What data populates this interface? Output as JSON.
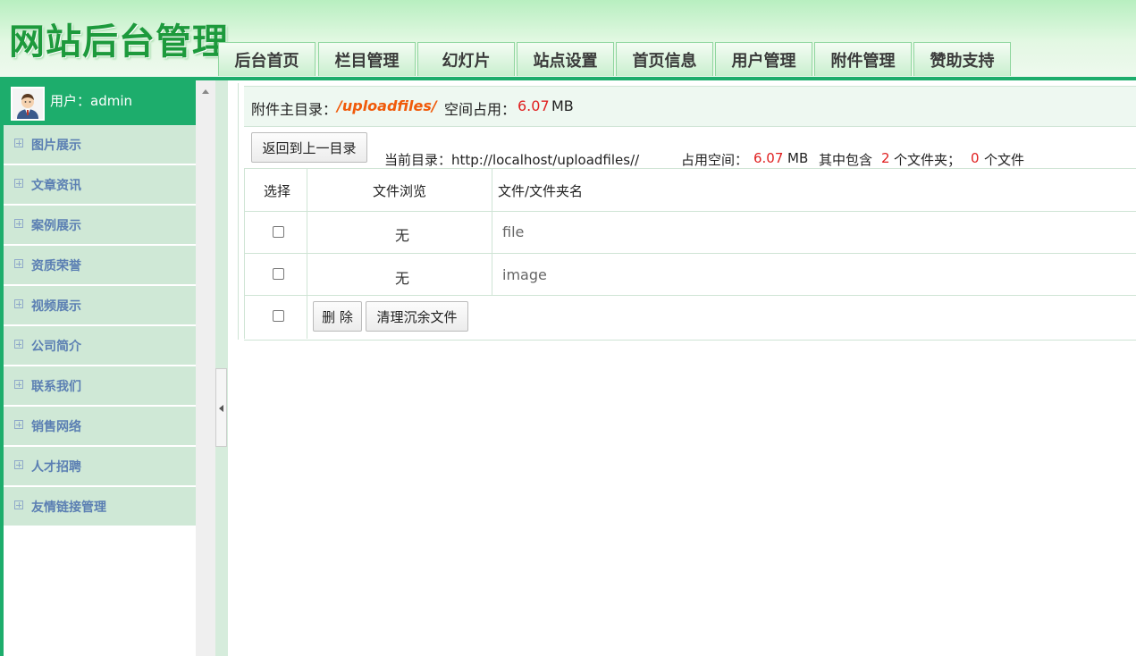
{
  "app": {
    "title": "网站后台管理"
  },
  "nav": {
    "tabs": [
      {
        "label": "后台首页"
      },
      {
        "label": "栏目管理"
      },
      {
        "label": "幻灯片"
      },
      {
        "label": "站点设置"
      },
      {
        "label": "首页信息"
      },
      {
        "label": "用户管理"
      },
      {
        "label": "附件管理"
      },
      {
        "label": "赞助支持"
      }
    ]
  },
  "sidebar": {
    "user_label": "用户：admin",
    "items": [
      {
        "label": "图片展示"
      },
      {
        "label": "文章资讯"
      },
      {
        "label": "案例展示"
      },
      {
        "label": "资质荣誉"
      },
      {
        "label": "视频展示"
      },
      {
        "label": "公司简介"
      },
      {
        "label": "联系我们"
      },
      {
        "label": "销售网络"
      },
      {
        "label": "人才招聘"
      },
      {
        "label": "友情链接管理"
      }
    ]
  },
  "info": {
    "root_label": "附件主目录：",
    "root_path": "/uploadfiles/",
    "space_label": "空间占用：",
    "space_value": "6.07",
    "space_unit": "MB"
  },
  "directory": {
    "back_button": "返回到上一目录",
    "current_label": "当前目录：http://localhost/uploadfiles//",
    "used_label": "占用空间：",
    "used_value": "6.07",
    "used_unit": "MB",
    "contains_label": "其中包含",
    "folder_count": "2",
    "folder_unit": "个文件夹；",
    "file_count": "0",
    "file_unit": "个文件"
  },
  "table": {
    "headers": [
      "选择",
      "文件浏览",
      "文件/文件夹名"
    ],
    "rows": [
      {
        "preview": "无",
        "name": "file"
      },
      {
        "preview": "无",
        "name": "image"
      }
    ],
    "delete_button": "删 除",
    "cleanup_button": "清理沉余文件"
  },
  "colors": {
    "accent": "#1dad6c",
    "menu_bg": "#cfe8d6",
    "menu_text": "#5b7fb3",
    "highlight_red": "#e02020",
    "path_orange": "#f05a0a"
  }
}
